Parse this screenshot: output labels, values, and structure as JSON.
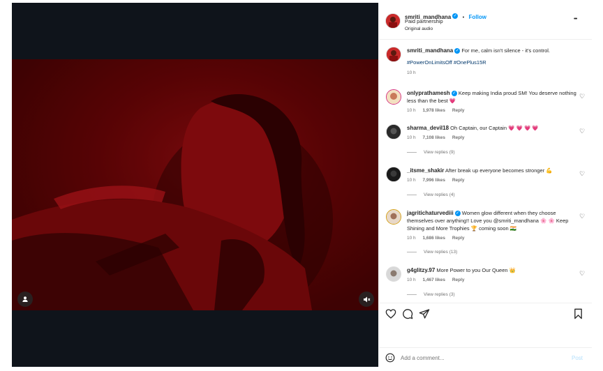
{
  "post": {
    "author": "smriti_mandhana",
    "follow_label": "Follow",
    "dot": "•",
    "subtitle": "Paid partnership",
    "audio": "Original audio",
    "more": "•••"
  },
  "caption": {
    "author": "smriti_mandhana",
    "text": "For me, calm isn't silence - it's control.",
    "hashtags": "#PowerOnLimitsOff #OnePlus15R",
    "time": "10 h"
  },
  "comments": [
    {
      "user": "onlyprathamesh",
      "text": "Keep making India proud SM! You deserve nothing less than the best 💗",
      "time": "10 h",
      "likes": "1,978 likes",
      "reply": "Reply",
      "view_replies": ""
    },
    {
      "user": "sharma_devil18",
      "text": "Oh Captain, our Captain 💗 💗 💗 💗",
      "time": "10 h",
      "likes": "7,108 likes",
      "reply": "Reply",
      "view_replies": "View replies (9)"
    },
    {
      "user": "_itsme_shakir",
      "text": "After break up everyone becomes stronger 💪",
      "time": "10 h",
      "likes": "7,996 likes",
      "reply": "Reply",
      "view_replies": "View replies (4)"
    },
    {
      "user": "jagritichaturvediii",
      "text": "Women glow different when they choose themselves over anything!! Love you @smriti_mandhana 🌸 🌸 Keep Shining and More Trophies 🏆 coming soon 🇮🇳",
      "time": "10 h",
      "likes": "1,686 likes",
      "reply": "Reply",
      "view_replies": "View replies (13)"
    },
    {
      "user": "g4glitzy.97",
      "text": "More Power to you Our Queen 👑",
      "time": "10 h",
      "likes": "1,467 likes",
      "reply": "Reply",
      "view_replies": "View replies (3)"
    }
  ],
  "add_comment": {
    "placeholder": "Add a comment...",
    "post_label": "Post"
  },
  "colors": {
    "accent": "#0095f6",
    "heart": "#e1306c",
    "muted": "#737373"
  }
}
